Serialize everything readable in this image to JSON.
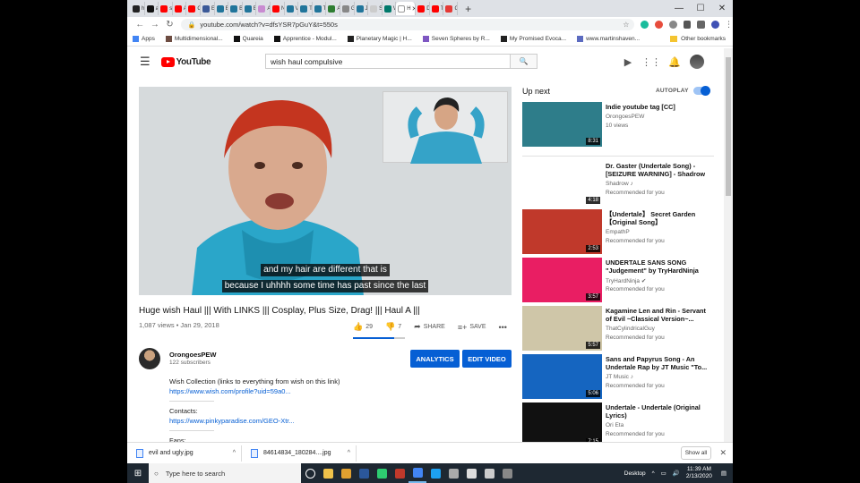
{
  "browser": {
    "tabs": [
      {
        "letter": "h",
        "color": "#222222"
      },
      {
        "letter": "a",
        "color": "#111111"
      },
      {
        "letter": "s",
        "color": "#ff0000"
      },
      {
        "letter": "A",
        "color": "#ff0000"
      },
      {
        "letter": "C",
        "color": "#ff0000"
      },
      {
        "letter": "E",
        "color": "#3b5998"
      },
      {
        "letter": "B",
        "color": "#21759b"
      },
      {
        "letter": "B",
        "color": "#21759b"
      },
      {
        "letter": "E",
        "color": "#21759b"
      },
      {
        "letter": "A",
        "color": "#c98bd1"
      },
      {
        "letter": "N",
        "color": "#ff0000"
      },
      {
        "letter": "V",
        "color": "#21759b"
      },
      {
        "letter": "T",
        "color": "#21759b"
      },
      {
        "letter": "T",
        "color": "#21759b"
      },
      {
        "letter": "A",
        "color": "#2e7d32"
      },
      {
        "letter": "G",
        "color": "#888888"
      },
      {
        "letter": "J",
        "color": "#21759b"
      },
      {
        "letter": "S",
        "color": "#cccccc"
      },
      {
        "letter": "V",
        "color": "#00796b"
      },
      {
        "letter": "H",
        "color": "#ffffff",
        "active": true
      },
      {
        "letter": "D",
        "color": "#ff0000"
      },
      {
        "letter": "T",
        "color": "#ff0000"
      },
      {
        "letter": "C",
        "color": "#e53935"
      }
    ],
    "new_tab": "+",
    "url": "youtube.com/watch?v=dfsYSR7pGuY&t=550s",
    "bookmarks": [
      {
        "label": "Apps",
        "color": "#4285f4"
      },
      {
        "label": "Multidimensional...",
        "color": "#6d4c41"
      },
      {
        "label": "Quareia",
        "color": "#111111"
      },
      {
        "label": "Apprentice - Modul...",
        "color": "#111111"
      },
      {
        "label": "Planetary Magic | H...",
        "color": "#222222"
      },
      {
        "label": "Seven Spheres by R...",
        "color": "#7e57c2"
      },
      {
        "label": "My Promised Evoca...",
        "color": "#222222"
      },
      {
        "label": "www.martinshaven...",
        "color": "#5c6bc0"
      }
    ],
    "other_bookmarks": "Other bookmarks"
  },
  "youtube": {
    "logo_text": "YouTube",
    "search_value": "wish haul compulsive",
    "video": {
      "caption_lines": [
        "and my hair are different that is",
        "because I uhhhh some time has past since the last"
      ],
      "title": "Huge wish Haul ||| With LINKS ||| Cosplay, Plus Size, Drag! ||| Haul A |||",
      "views": "1,087 views • Jan 29, 2018",
      "likes": "29",
      "dislikes": "7",
      "share": "SHARE",
      "save": "SAVE",
      "like_ratio": 0.8
    },
    "channel": {
      "name": "OrongoesPEW",
      "subs": "122 subscribers",
      "analytics": "ANALYTICS",
      "edit": "EDIT VIDEO"
    },
    "description": {
      "line1": "Wish Collection (links to everything from wish on this link)",
      "link1": "https://www.wish.com/profile?uid=59a0...",
      "sep": "-------------------------",
      "contacts": "Contacts:",
      "link2": "https://www.pinkyparadise.com/GEO-Xtr...",
      "sep2": "-------------------------",
      "fans": "Fans:"
    },
    "sidebar": {
      "up_next": "Up next",
      "autoplay": "AUTOPLAY",
      "videos": [
        {
          "title": "Indie youtube tag [CC]",
          "channel": "OrongoesPEW",
          "meta": "10 views",
          "duration": "8:31",
          "bg": "#2e7d8a"
        },
        {
          "title": "Dr. Gaster (Undertale Song) - [SEIZURE WARNING] - Shadrow",
          "channel": "Shadrow ♪",
          "meta": "Recommended for you",
          "duration": "4:18",
          "bg": "#ffffff"
        },
        {
          "title": "【Undertale】 Secret Garden 【Original Song】",
          "channel": "EmpathP",
          "meta": "Recommended for you",
          "duration": "2:53",
          "bg": "#c0392b"
        },
        {
          "title": "UNDERTALE SANS SONG \"Judgement\" by TryHardNinja",
          "channel": "TryHardNinja ✔",
          "meta": "Recommended for you",
          "duration": "3:57",
          "bg": "#e91e63"
        },
        {
          "title": "Kagamine Len and Rin - Servant of Evil ~Classical Version~...",
          "channel": "ThatCylindricalGuy",
          "meta": "Recommended for you",
          "duration": "5:57",
          "bg": "#cfc6a8"
        },
        {
          "title": "Sans and Papyrus Song - An Undertale Rap by JT Music \"To...",
          "channel": "JT Music ♪",
          "meta": "Recommended for you",
          "duration": "5:06",
          "bg": "#1565c0"
        },
        {
          "title": "Undertale - Undertale (Original Lyrics)",
          "channel": "Ori Eta",
          "meta": "Recommended for you",
          "duration": "7:15",
          "bg": "#111111"
        }
      ]
    }
  },
  "downloads": {
    "items": [
      "evil and ugly.jpg",
      "84614834_180284....jpg"
    ],
    "show_all": "Show all"
  },
  "taskbar": {
    "search_placeholder": "Type here to search",
    "desktop": "Desktop",
    "time": "11:39 AM",
    "date": "2/13/2020",
    "app_colors": [
      "#f0c24a",
      "#e0a030",
      "#2b579a",
      "#2ecc71",
      "#c0392b",
      "#4285f4",
      "#1da1f2",
      "#aaaaaa",
      "#dddddd",
      "#cccccc",
      "#888888"
    ]
  }
}
